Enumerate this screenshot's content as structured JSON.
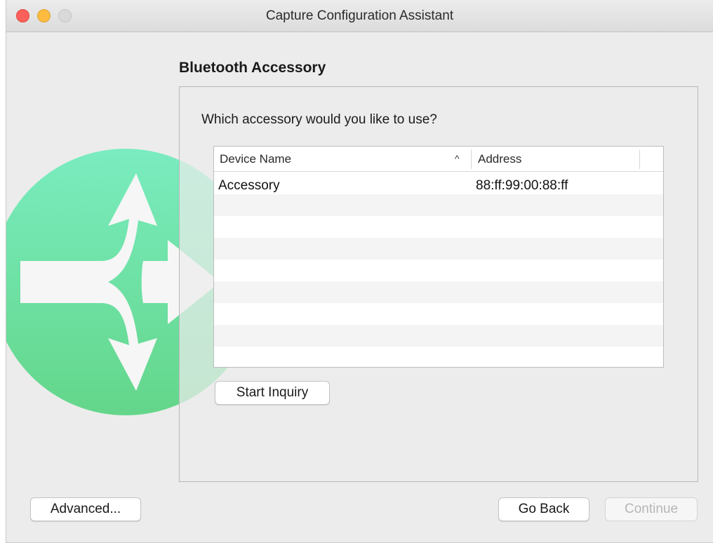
{
  "window": {
    "title": "Capture Configuration Assistant"
  },
  "page": {
    "heading": "Bluetooth Accessory",
    "question": "Which accessory would you like to use?"
  },
  "table": {
    "columns": {
      "name": "Device Name",
      "address": "Address"
    },
    "sort": {
      "column": "Device Name",
      "direction": "ascending",
      "indicator": "^"
    },
    "rows": [
      {
        "name": "Accessory",
        "address": "88:ff:99:00:88:ff"
      },
      {
        "name": "",
        "address": ""
      },
      {
        "name": "",
        "address": ""
      },
      {
        "name": "",
        "address": ""
      },
      {
        "name": "",
        "address": ""
      },
      {
        "name": "",
        "address": ""
      },
      {
        "name": "",
        "address": ""
      },
      {
        "name": "",
        "address": ""
      },
      {
        "name": "",
        "address": ""
      }
    ]
  },
  "buttons": {
    "start_inquiry": "Start Inquiry",
    "advanced": "Advanced...",
    "go_back": "Go Back",
    "continue": "Continue"
  },
  "colors": {
    "close": "#fc605b",
    "minimize": "#fdbc40",
    "zoom": "#d9d9d9",
    "logo_green": "#6fe8b0",
    "disabled_text": "#b6b6b6"
  },
  "icons": {
    "logo": "branching-arrows-icon",
    "sort": "chevron-up-icon"
  }
}
